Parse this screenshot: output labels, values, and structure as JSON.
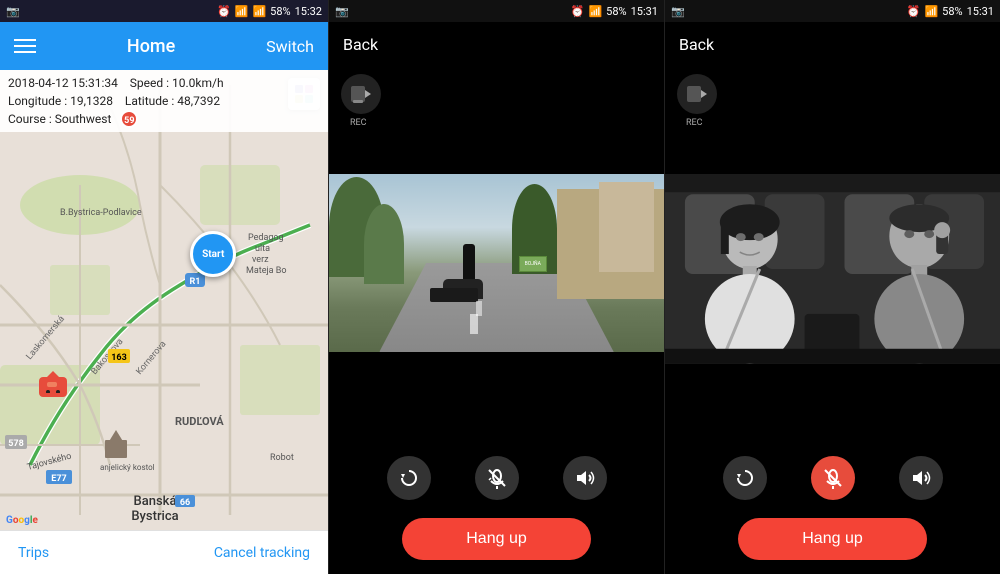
{
  "panel_map": {
    "status_bar": {
      "left_icon": "☰",
      "time": "15:32",
      "battery": "58%",
      "signal_icon": "📶"
    },
    "header": {
      "title": "Home",
      "switch_label": "Switch",
      "menu_icon": "menu"
    },
    "info": {
      "date_time": "2018-04-12  15:31:34",
      "speed_label": "Speed :",
      "speed_value": "10.0km/h",
      "longitude_label": "Longitude :",
      "longitude_value": "19,1328",
      "latitude_label": "Latitude :",
      "latitude_value": "48,7392",
      "course_label": "Course :",
      "course_value": "Southwest",
      "speed_limit": "59"
    },
    "map": {
      "start_label": "Start",
      "city_name": "Banská\nBystrica",
      "district_label": "B.Bystrica-Podlavice",
      "rudlova_label": "RUDĽOVÁ",
      "road_163": "163",
      "road_e77": "E77",
      "road_578": "578",
      "road_66": "66",
      "pedagog_label": "Pedagog",
      "robot_label": "Robot"
    },
    "bottom": {
      "trips_label": "Trips",
      "cancel_label": "Cancel tracking"
    }
  },
  "panel_camera1": {
    "status_bar": {
      "time": "15:31",
      "battery": "58%"
    },
    "header": {
      "back_label": "Back"
    },
    "rec_label": "REC",
    "controls": {
      "rotate_icon": "↻",
      "mute_icon": "🎤",
      "volume_icon": "🔊"
    },
    "hang_up": {
      "label": "Hang up"
    }
  },
  "panel_camera2": {
    "status_bar": {
      "time": "15:31",
      "battery": "58%"
    },
    "header": {
      "back_label": "Back"
    },
    "rec_label": "REC",
    "controls": {
      "rotate_icon": "↻",
      "mute_icon": "🎤",
      "volume_icon": "🔊"
    },
    "hang_up": {
      "label": "Hang up"
    }
  },
  "icons": {
    "camera": "📹",
    "rec": "REC",
    "rotate": "↻",
    "mute": "🎙",
    "volume": "🔊"
  },
  "colors": {
    "header_blue": "#2196F3",
    "hang_up_red": "#F44336",
    "rec_dark": "#222222",
    "route_green": "#4CAF50",
    "map_bg": "#e8e0d8"
  }
}
